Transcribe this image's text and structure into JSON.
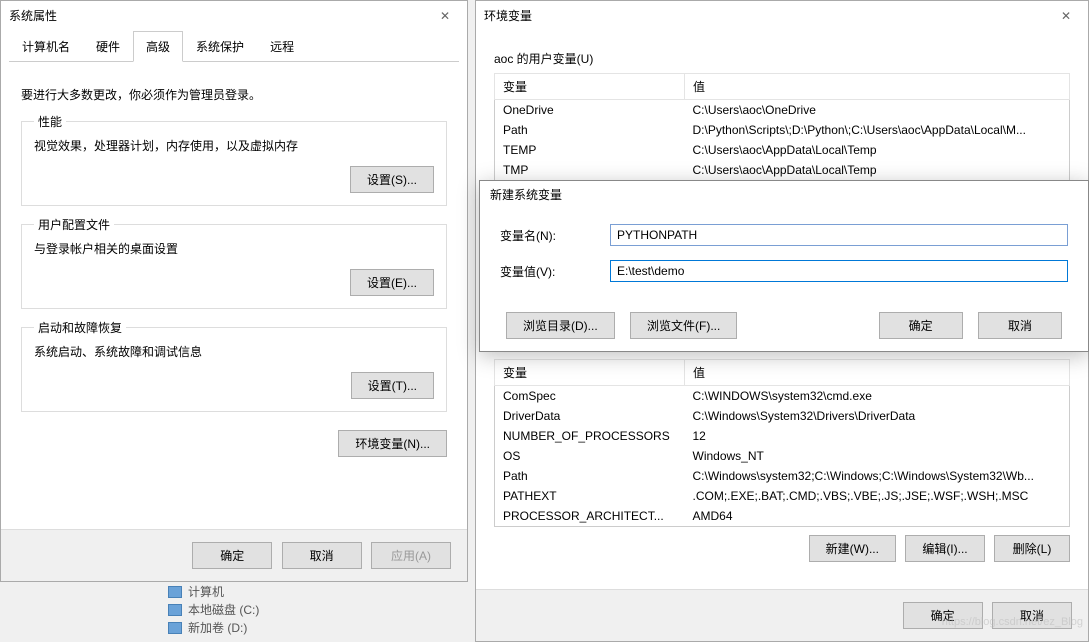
{
  "sysprops": {
    "title": "系统属性",
    "tabs": [
      "计算机名",
      "硬件",
      "高级",
      "系统保护",
      "远程"
    ],
    "active_tab": "高级",
    "admin_note": "要进行大多数更改，你必须作为管理员登录。",
    "perf": {
      "title": "性能",
      "desc": "视觉效果，处理器计划，内存使用，以及虚拟内存",
      "btn": "设置(S)..."
    },
    "profile": {
      "title": "用户配置文件",
      "desc": "与登录帐户相关的桌面设置",
      "btn": "设置(E)..."
    },
    "startup": {
      "title": "启动和故障恢复",
      "desc": "系统启动、系统故障和调试信息",
      "btn": "设置(T)..."
    },
    "envvar_btn": "环境变量(N)...",
    "ok": "确定",
    "cancel": "取消",
    "apply": "应用(A)"
  },
  "envvars": {
    "title": "环境变量",
    "user_section": "aoc 的用户变量(U)",
    "cols": {
      "name": "变量",
      "value": "值"
    },
    "user_rows": [
      {
        "name": "OneDrive",
        "value": "C:\\Users\\aoc\\OneDrive"
      },
      {
        "name": "Path",
        "value": "D:\\Python\\Scripts\\;D:\\Python\\;C:\\Users\\aoc\\AppData\\Local\\M..."
      },
      {
        "name": "TEMP",
        "value": "C:\\Users\\aoc\\AppData\\Local\\Temp"
      },
      {
        "name": "TMP",
        "value": "C:\\Users\\aoc\\AppData\\Local\\Temp"
      }
    ],
    "sys_rows": [
      {
        "name": "ComSpec",
        "value": "C:\\WINDOWS\\system32\\cmd.exe"
      },
      {
        "name": "DriverData",
        "value": "C:\\Windows\\System32\\Drivers\\DriverData"
      },
      {
        "name": "NUMBER_OF_PROCESSORS",
        "value": "12"
      },
      {
        "name": "OS",
        "value": "Windows_NT"
      },
      {
        "name": "Path",
        "value": "C:\\Windows\\system32;C:\\Windows;C:\\Windows\\System32\\Wb..."
      },
      {
        "name": "PATHEXT",
        "value": ".COM;.EXE;.BAT;.CMD;.VBS;.VBE;.JS;.JSE;.WSF;.WSH;.MSC"
      },
      {
        "name": "PROCESSOR_ARCHITECT...",
        "value": "AMD64"
      }
    ],
    "new_btn": "新建(W)...",
    "edit_btn": "编辑(I)...",
    "del_btn": "删除(L)",
    "ok": "确定",
    "cancel": "取消"
  },
  "newvar": {
    "title": "新建系统变量",
    "name_label": "变量名(N):",
    "name_value": "PYTHONPATH",
    "value_label": "变量值(V):",
    "value_value": "E:\\test\\demo",
    "browse_dir": "浏览目录(D)...",
    "browse_file": "浏览文件(F)...",
    "ok": "确定",
    "cancel": "取消"
  },
  "desktop": {
    "computer": "计算机",
    "disk_c": "本地磁盘 (C:)",
    "disk_d": "新加卷 (D:)"
  },
  "watermark": "https://blog.csdn.net/ez_Blog"
}
